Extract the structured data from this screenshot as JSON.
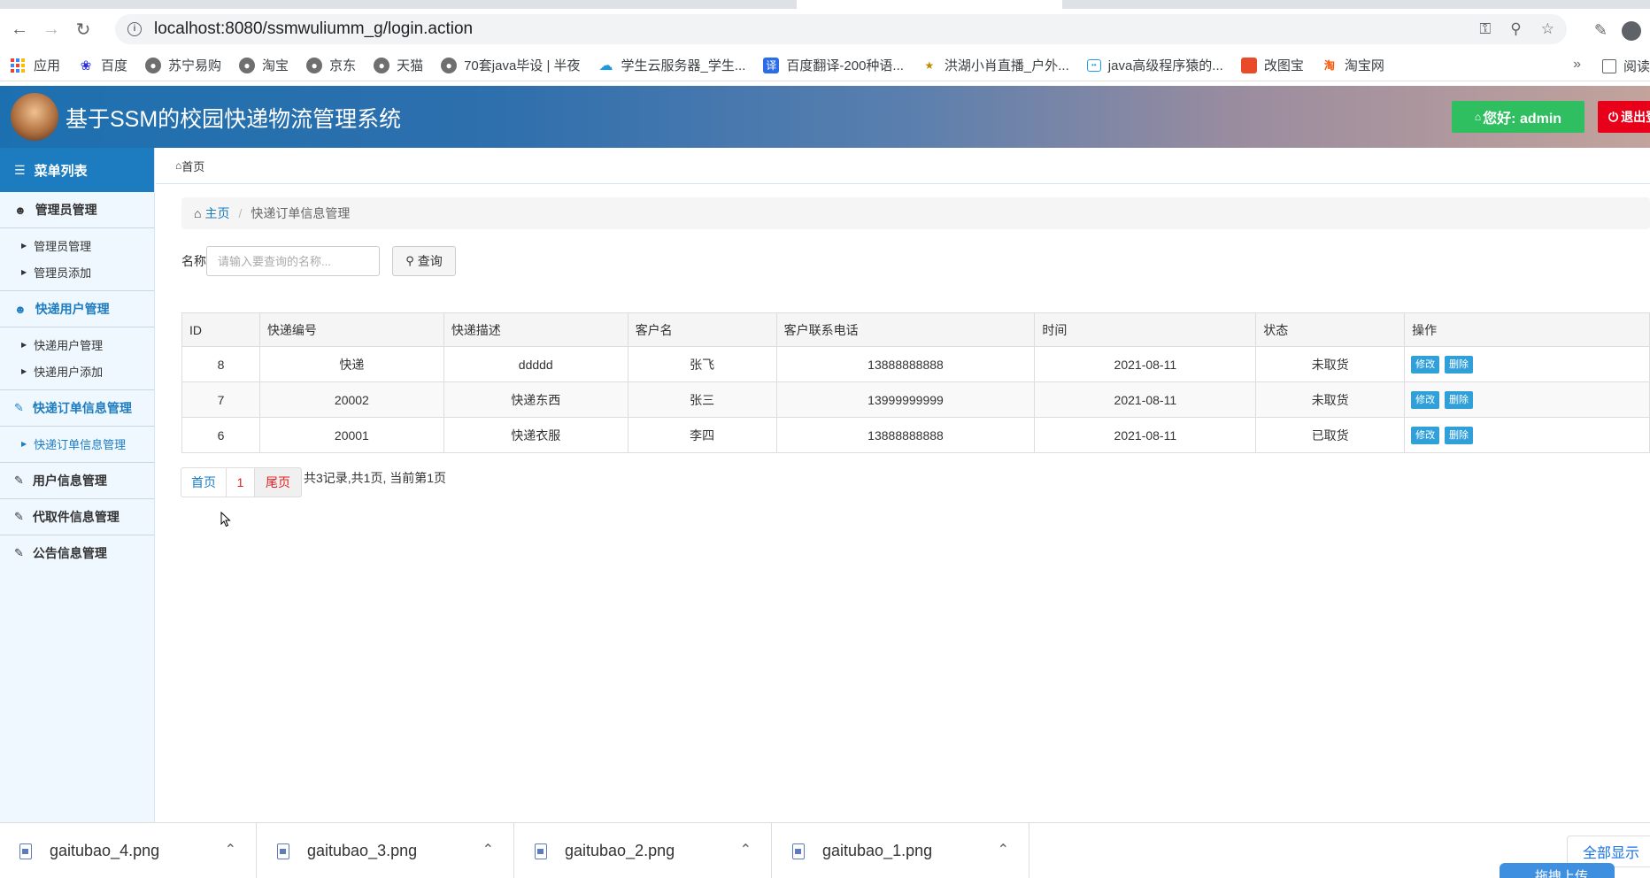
{
  "browser": {
    "url": "localhost:8080/ssmwuliumm_g/login.action",
    "bookmarks": [
      {
        "label": "应用",
        "icon": "apps-icon"
      },
      {
        "label": "百度",
        "icon": "baidu-icon"
      },
      {
        "label": "苏宁易购",
        "icon": "globe-icon"
      },
      {
        "label": "淘宝",
        "icon": "globe-icon"
      },
      {
        "label": "京东",
        "icon": "globe-icon"
      },
      {
        "label": "天猫",
        "icon": "globe-icon"
      },
      {
        "label": "70套java毕设 | 半夜",
        "icon": "globe-icon"
      },
      {
        "label": "学生云服务器_学生...",
        "icon": "cloud-icon"
      },
      {
        "label": "百度翻译-200种语...",
        "icon": "translate-icon"
      },
      {
        "label": "洪湖小肖直播_户外...",
        "icon": "live-icon"
      },
      {
        "label": "java高级程序猿的...",
        "icon": "bilibili-icon"
      },
      {
        "label": "改图宝",
        "icon": "image-icon"
      },
      {
        "label": "淘宝网",
        "icon": "taobao-icon"
      }
    ],
    "more": "»",
    "reading_list": "阅读"
  },
  "header": {
    "title": "基于SSM的校园快递物流管理系统",
    "hello": "您好: admin",
    "logout": "退出登"
  },
  "sidebar": {
    "menu_title": "菜单列表",
    "groups": [
      {
        "title": "管理员管理",
        "items": [
          "管理员管理",
          "管理员添加"
        ]
      },
      {
        "title": "快递用户管理",
        "items": [
          "快递用户管理",
          "快递用户添加"
        ]
      },
      {
        "title": "快递订单信息管理",
        "items": [
          "快递订单信息管理"
        ]
      },
      {
        "title": "用户信息管理",
        "items": []
      },
      {
        "title": "代取件信息管理",
        "items": []
      },
      {
        "title": "公告信息管理",
        "items": []
      }
    ]
  },
  "content": {
    "top_crumb": "首页",
    "breadcrumb": {
      "home": "主页",
      "current": "快递订单信息管理"
    },
    "search": {
      "label": "名称",
      "placeholder": "请输入要查询的名称...",
      "button": "查询"
    },
    "table": {
      "headers": [
        "ID",
        "快递编号",
        "快递描述",
        "客户名",
        "客户联系电话",
        "时间",
        "状态",
        "操作"
      ],
      "rows": [
        {
          "id": "8",
          "code": "快递",
          "desc": "ddddd",
          "customer": "张飞",
          "phone": "13888888888",
          "time": "2021-08-11",
          "status": "未取货"
        },
        {
          "id": "7",
          "code": "20002",
          "desc": "快递东西",
          "customer": "张三",
          "phone": "13999999999",
          "time": "2021-08-11",
          "status": "未取货"
        },
        {
          "id": "6",
          "code": "20001",
          "desc": "快递衣服",
          "customer": "李四",
          "phone": "13888888888",
          "time": "2021-08-11",
          "status": "已取货"
        }
      ],
      "edit_label": "修改",
      "delete_label": "删除"
    },
    "pager": {
      "first": "首页",
      "page": "1",
      "last": "尾页",
      "info": "共3记录,共1页, 当前第1页"
    }
  },
  "downloads": {
    "files": [
      "gaitubao_4.png",
      "gaitubao_3.png",
      "gaitubao_2.png",
      "gaitubao_1.png"
    ],
    "show_all": "全部显示",
    "drag_upload": "拖拽上传"
  }
}
